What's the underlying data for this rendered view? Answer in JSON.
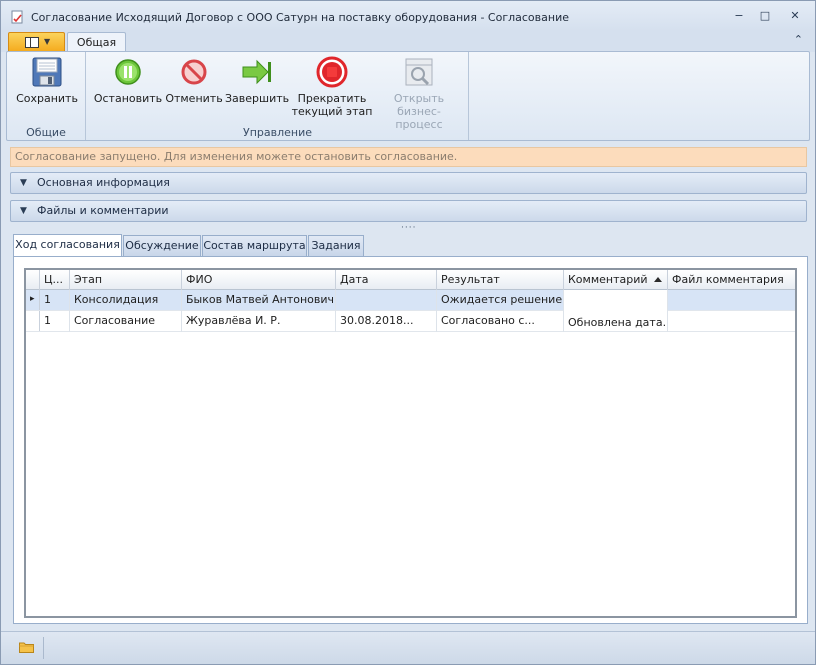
{
  "window": {
    "title": "Согласование Исходящий Договор с ООО Сатурн на поставку оборудования - Согласование",
    "minimize": "−",
    "maximize": "□",
    "close": "✕"
  },
  "ribbon_tabs": {
    "active": "Общая",
    "collapse_glyph": "⌃"
  },
  "ribbon": {
    "group_general": {
      "label": "Общие",
      "save": "Сохранить"
    },
    "group_control": {
      "label": "Управление",
      "stop": "Остановить",
      "cancel": "Отменить",
      "finish": "Завершить",
      "terminate_line1": "Прекратить",
      "terminate_line2": "текущий этап",
      "open_line1": "Открыть",
      "open_line2": "бизнес-процесс"
    }
  },
  "info_bar": "Согласование запущено. Для изменения можете остановить согласование.",
  "sections": {
    "main_info": "Основная информация",
    "files": "Файлы и комментарии",
    "splitter": "····"
  },
  "page_tabs": [
    "Ход согласования",
    "Обсуждение",
    "Состав маршрута",
    "Задания"
  ],
  "grid": {
    "columns": [
      "Ц...",
      "Этап",
      "ФИО",
      "Дата",
      "Результат",
      "Комментарий",
      "Файл комментария"
    ],
    "rows": [
      [
        "1",
        "Консолидация",
        "Быков Матвей Антонович",
        "",
        "Ожидается решение",
        "",
        ""
      ],
      [
        "1",
        "Согласование",
        "Журавлёва И. Р.",
        "30.08.2018...",
        "Согласовано с...",
        "Обновлена дата...",
        ""
      ]
    ],
    "row_indicator": "▸"
  },
  "colors": {
    "accent_orange": "#f4a91c",
    "info_bg": "#fcdcbc",
    "selected_row": "#d7e4f6",
    "stop_red": "#e0262b",
    "play_green": "#5dbb2a"
  }
}
